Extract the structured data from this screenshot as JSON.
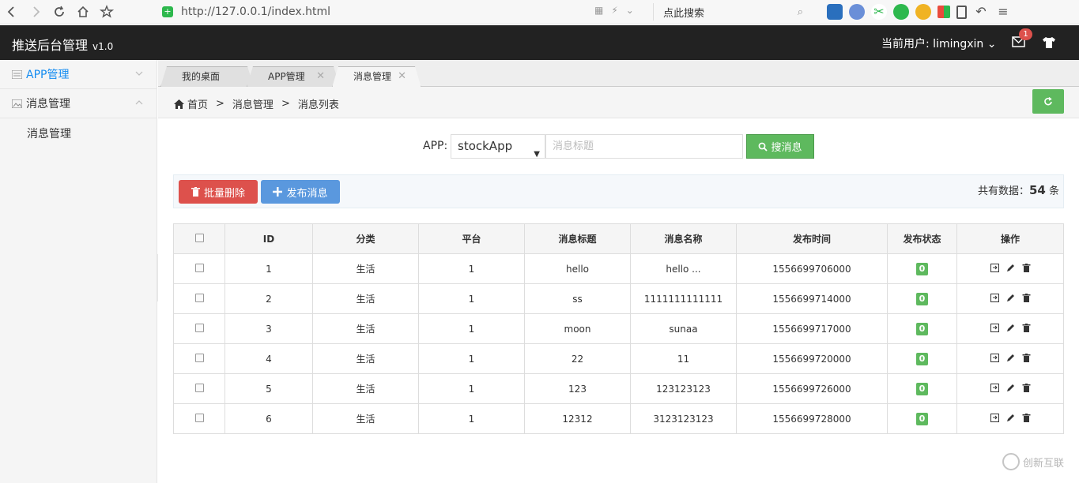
{
  "browser": {
    "url": "http://127.0.0.1/index.html",
    "search_placeholder": "点此搜索"
  },
  "header": {
    "title": "推送后台管理",
    "version": "v1.0",
    "user_label": "当前用户:",
    "user_name": "limingxin",
    "mail_badge": "1"
  },
  "sidebar": {
    "items": [
      {
        "label": "APP管理"
      },
      {
        "label": "消息管理"
      }
    ],
    "sub_items": [
      {
        "label": "消息管理"
      }
    ]
  },
  "tabs": [
    {
      "label": "我的桌面"
    },
    {
      "label": "APP管理"
    },
    {
      "label": "消息管理"
    }
  ],
  "breadcrumb": {
    "home": "首页",
    "sep": ">",
    "level1": "消息管理",
    "level2": "消息列表"
  },
  "search": {
    "app_label": "APP:",
    "app_value": "stockApp",
    "title_placeholder": "消息标题",
    "button_label": "搜消息"
  },
  "toolbar": {
    "batch_delete": "批量删除",
    "publish": "发布消息",
    "count_prefix": "共有数据：",
    "count": "54",
    "count_suffix": "条"
  },
  "table": {
    "headers": [
      "ID",
      "分类",
      "平台",
      "消息标题",
      "消息名称",
      "发布时间",
      "发布状态",
      "操作"
    ],
    "rows": [
      {
        "id": "1",
        "category": "生活",
        "platform": "1",
        "title": "hello",
        "name": "hello ...",
        "time": "1556699706000",
        "status": "0"
      },
      {
        "id": "2",
        "category": "生活",
        "platform": "1",
        "title": "ss",
        "name": "1111111111111",
        "time": "1556699714000",
        "status": "0"
      },
      {
        "id": "3",
        "category": "生活",
        "platform": "1",
        "title": "moon",
        "name": "sunaa",
        "time": "1556699717000",
        "status": "0"
      },
      {
        "id": "4",
        "category": "生活",
        "platform": "1",
        "title": "22",
        "name": "11",
        "time": "1556699720000",
        "status": "0"
      },
      {
        "id": "5",
        "category": "生活",
        "platform": "1",
        "title": "123",
        "name": "123123123",
        "time": "1556699726000",
        "status": "0"
      },
      {
        "id": "6",
        "category": "生活",
        "platform": "1",
        "title": "12312",
        "name": "3123123123",
        "time": "1556699728000",
        "status": "0"
      }
    ]
  },
  "watermark": "创新互联",
  "colors": {
    "header_bg": "#222222",
    "accent_blue": "#148cf1",
    "success": "#5eb95e",
    "danger": "#dd514c",
    "primary": "#5a98de"
  }
}
